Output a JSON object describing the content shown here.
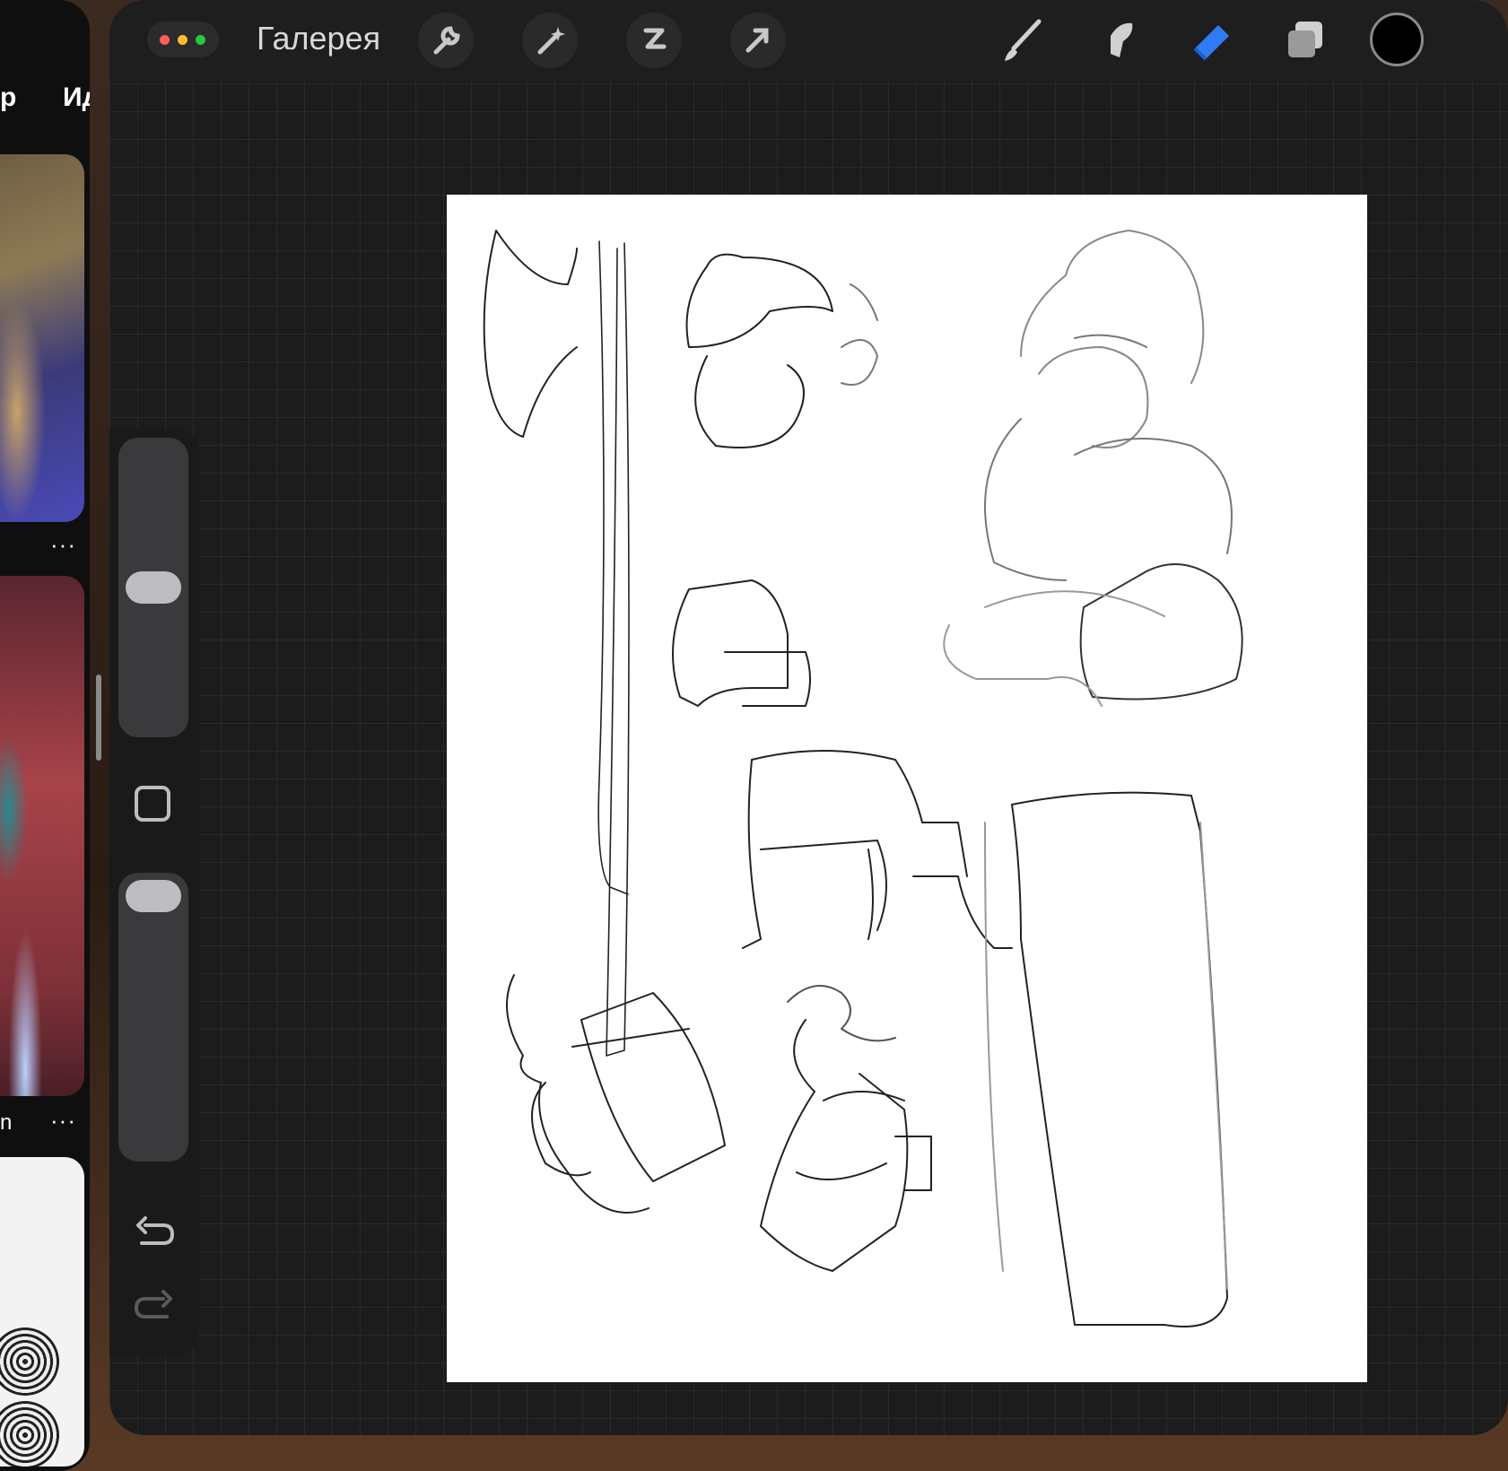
{
  "left_app": {
    "tab_1": "р",
    "tab_2": "Ид",
    "caption_1": "",
    "caption_2": "n",
    "more_glyph": "···"
  },
  "toolbar": {
    "window_controls": [
      "red-dot",
      "yellow-dot",
      "green-dot"
    ],
    "gallery_label": "Галерея",
    "actions_icon": "wrench-icon",
    "adjustments_icon": "magic-wand-icon",
    "selection_icon": "selection-s-icon",
    "transform_icon": "arrow-cursor-icon",
    "brush_icon": "brush-icon",
    "smudge_icon": "smudge-icon",
    "eraser_icon": "eraser-icon",
    "layers_icon": "layers-icon",
    "current_color": "#000000"
  },
  "colors": {
    "accent": "#2f7cf6",
    "dot_red": "#ff5f57",
    "dot_yellow": "#febc2e",
    "dot_green": "#28c840"
  },
  "sidebar": {
    "brush_size_level": 0.5,
    "opacity_level": 0.0,
    "modify_icon": "square-icon",
    "undo_icon": "undo-icon",
    "redo_icon": "redo-icon"
  }
}
